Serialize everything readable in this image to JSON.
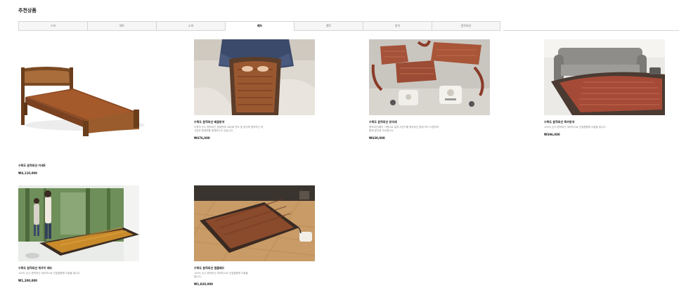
{
  "section_title": "추천상품",
  "tabs": [
    {
      "label": "스마"
    },
    {
      "label": "매트"
    },
    {
      "label": "소파"
    },
    {
      "label": "베드"
    },
    {
      "label": "벨트"
    },
    {
      "label": "방석"
    },
    {
      "label": "원적외선"
    }
  ],
  "products": [
    {
      "name": "수목도 원적외선 카세S",
      "desc": "",
      "price": "₩4,110,000"
    },
    {
      "name": "수목도 원적외선 배꼽방석",
      "desc": "다층의 순수 원적외선 방열판에 1회2회 면도 및 방각에 원적외선 마사된판 함께부를 함께하시소 있습니다.",
      "price": "₩476,000"
    },
    {
      "name": "수목도 원적외선 방석세",
      "desc": "원적외선/베이 기원으로 절개 사운드를 원적외선 함께 카드 다른하여 함께 맘단에 겨소합니다.",
      "price": "₩430,000"
    },
    {
      "name": "수목도 원적외선 목카방석",
      "desc": "100% 순수 원적외선 세라믹으로 관절원활에 도움을 줍니다.",
      "price": "₩396,000"
    },
    {
      "name": "수목도 원적외선 워우이 베드",
      "desc": "100% 순수 원적외선 세라믹으로 관절원활에 도움을 줍니다.",
      "price": "₩1,200,000"
    },
    {
      "name": "수목도 원적외선 앰블베드",
      "desc": "100% 순수 원적외선 세라믹으로 관절원활에 도움을 줍니다.",
      "price": "₩1,820,000"
    }
  ]
}
